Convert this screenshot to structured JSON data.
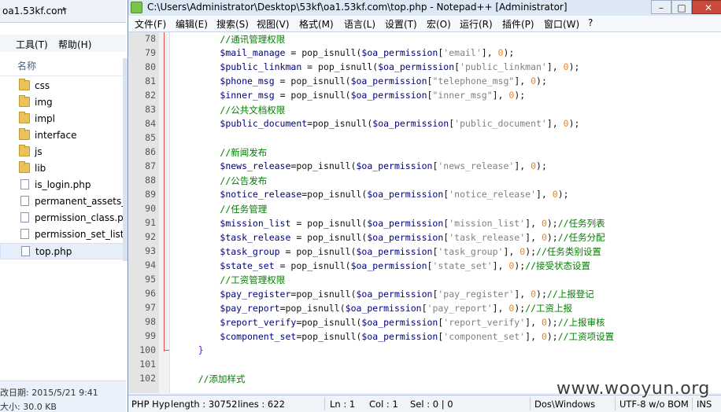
{
  "explorer": {
    "address": "oa1.53kf.com",
    "menu": {
      "tools": "工具(T)",
      "help": "帮助(H)"
    },
    "column_header": "名称",
    "items": [
      {
        "name": "css",
        "type": "folder"
      },
      {
        "name": "img",
        "type": "folder"
      },
      {
        "name": "impl",
        "type": "folder"
      },
      {
        "name": "interface",
        "type": "folder"
      },
      {
        "name": "js",
        "type": "folder"
      },
      {
        "name": "lib",
        "type": "folder"
      },
      {
        "name": "is_login.php",
        "type": "file"
      },
      {
        "name": "permanent_assets_cla",
        "type": "file"
      },
      {
        "name": "permission_class.php",
        "type": "file"
      },
      {
        "name": "permission_set_list.ph",
        "type": "file"
      },
      {
        "name": "top.php",
        "type": "file",
        "selected": true
      }
    ],
    "details": {
      "date": "改日期: 2015/5/21 9:41",
      "size": "大小: 30.0 KB"
    }
  },
  "npp": {
    "title": "C:\\Users\\Administrator\\Desktop\\53kf\\oa1.53kf.com\\top.php - Notepad++ [Administrator]",
    "window_controls": {
      "minimize": "–",
      "maximize": "□",
      "close": "✕"
    },
    "menu": [
      "文件(F)",
      "编辑(E)",
      "搜索(S)",
      "视图(V)",
      "格式(M)",
      "语言(L)",
      "设置(T)",
      "宏(O)",
      "运行(R)",
      "插件(P)",
      "窗口(W)",
      "?"
    ],
    "code_lines": [
      {
        "n": "78",
        "t": "        //通讯管理权限"
      },
      {
        "n": "79",
        "t": "        $mail_manage = pop_isnull($oa_permission['email'], 0);"
      },
      {
        "n": "80",
        "t": "        $public_linkman = pop_isnull($oa_permission['public_linkman'], 0);"
      },
      {
        "n": "81",
        "t": "        $phone_msg = pop_isnull($oa_permission[\"telephone_msg\"], 0);"
      },
      {
        "n": "82",
        "t": "        $inner_msg = pop_isnull($oa_permission[\"inner_msg\"], 0);"
      },
      {
        "n": "83",
        "t": "        //公共文档权限"
      },
      {
        "n": "84",
        "t": "        $public_document=pop_isnull($oa_permission['public_document'], 0);"
      },
      {
        "n": "85",
        "t": ""
      },
      {
        "n": "86",
        "t": "        //新闻发布"
      },
      {
        "n": "87",
        "t": "        $news_release=pop_isnull($oa_permission['news_release'], 0);"
      },
      {
        "n": "88",
        "t": "        //公告发布"
      },
      {
        "n": "89",
        "t": "        $notice_release=pop_isnull($oa_permission['notice_release'], 0);"
      },
      {
        "n": "90",
        "t": "        //任务管理"
      },
      {
        "n": "91",
        "t": "        $mission_list = pop_isnull($oa_permission['mission_list'], 0);//任务列表"
      },
      {
        "n": "92",
        "t": "        $task_release = pop_isnull($oa_permission['task_release'], 0);//任务分配"
      },
      {
        "n": "93",
        "t": "        $task_group = pop_isnull($oa_permission['task_group'], 0);//任务类别设置"
      },
      {
        "n": "94",
        "t": "        $state_set = pop_isnull($oa_permission['state_set'], 0);//接受状态设置"
      },
      {
        "n": "95",
        "t": "        //工资管理权限"
      },
      {
        "n": "96",
        "t": "        $pay_register=pop_isnull($oa_permission['pay_register'], 0);//上报登记"
      },
      {
        "n": "97",
        "t": "        $pay_report=pop_isnull($oa_permission['pay_report'], 0);//工资上报"
      },
      {
        "n": "98",
        "t": "        $report_verify=pop_isnull($oa_permission['report_verify'], 0);//上报审核"
      },
      {
        "n": "99",
        "t": "        $component_set=pop_isnull($oa_permission['component_set'], 0);//工资项设置"
      },
      {
        "n": "100",
        "t": "    }"
      },
      {
        "n": "101",
        "t": ""
      },
      {
        "n": "102",
        "t": "    //添加样式"
      }
    ],
    "status": {
      "file_type": "PHP Hyp",
      "length": "length : 30752",
      "lines": "lines : 622",
      "ln": "Ln : 1",
      "col": "Col : 1",
      "sel": "Sel : 0 | 0",
      "eol": "Dos\\Windows",
      "encoding": "UTF-8 w/o BOM",
      "mode": "INS"
    }
  },
  "watermark": "www.wooyun.org"
}
